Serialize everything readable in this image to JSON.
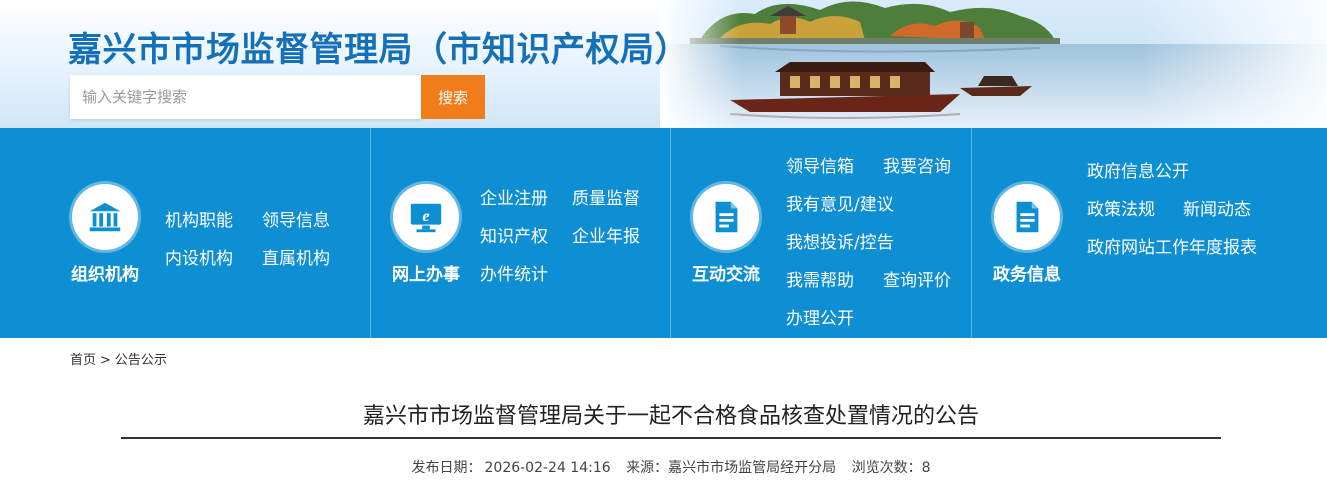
{
  "header": {
    "site_title": "嘉兴市市场监督管理局（市知识产权局）",
    "search_placeholder": "输入关键字搜索",
    "search_button": "搜索"
  },
  "nav": {
    "panels": [
      {
        "category": "组织机构",
        "icon": "building-columns-icon",
        "links": [
          "机构职能",
          "领导信息",
          "内设机构",
          "直属机构"
        ]
      },
      {
        "category": "网上办事",
        "icon": "e-monitor-icon",
        "links": [
          "企业注册",
          "质量监督",
          "知识产权",
          "企业年报",
          "办件统计"
        ]
      },
      {
        "category": "互动交流",
        "icon": "document-icon",
        "links": [
          "领导信箱",
          "我要咨询",
          "我有意见/建议",
          "我想投诉/控告",
          "我需帮助",
          "查询评价",
          "办理公开"
        ]
      },
      {
        "category": "政务信息",
        "icon": "document-icon",
        "links": [
          "政府信息公开",
          "政策法规",
          "新闻动态",
          "政府网站工作年度报表"
        ]
      }
    ]
  },
  "breadcrumb": {
    "home": "首页",
    "separator": ">",
    "current": "公告公示"
  },
  "article": {
    "title": "嘉兴市市场监督管理局关于一起不合格食品核查处置情况的公告",
    "publish_label": "发布日期：",
    "publish_date": "2026-02-24 14:16",
    "source_label": "来源：",
    "source": "嘉兴市市场监管局经开分局",
    "views_label": "浏览次数：",
    "views": "8"
  },
  "colors": {
    "brand_blue": "#1570b8",
    "nav_blue": "#0f8fd3",
    "search_orange": "#f07d1a"
  }
}
